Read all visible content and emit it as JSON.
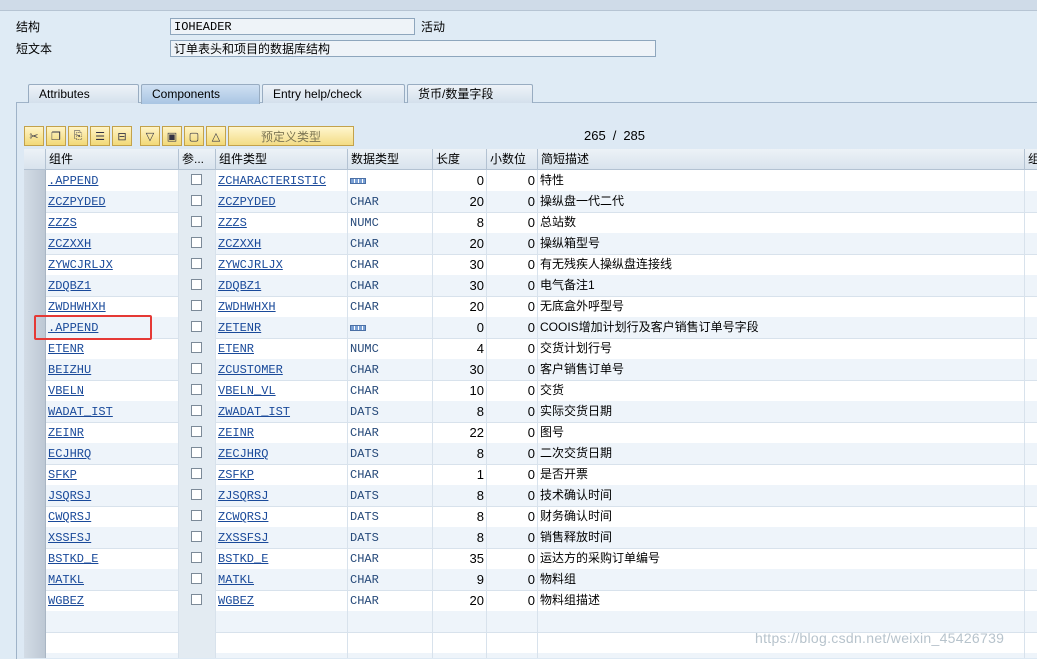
{
  "header": {
    "structure_label": "结构",
    "structure_value": "IOHEADER",
    "status": "活动",
    "shorttext_label": "短文本",
    "shorttext_value": "订单表头和项目的数据库结构"
  },
  "tabs": [
    {
      "label": "Attributes",
      "active": false
    },
    {
      "label": "Components",
      "active": true
    },
    {
      "label": "Entry help/check",
      "active": false
    },
    {
      "label": "货币/数量字段",
      "active": false
    }
  ],
  "toolbar": {
    "icons": [
      "cut-icon",
      "copy-icon",
      "paste-icon",
      "insert-row-icon",
      "delete-row-icon",
      "sort-icon",
      "select-all-icon",
      "deselect-icon",
      "scroll-up-icon"
    ],
    "predefined_type_label": "预定义类型"
  },
  "counter": {
    "current": "265",
    "separator": "/",
    "total": "285"
  },
  "columns": [
    "组件",
    "参...",
    "组件类型",
    "数据类型",
    "长度",
    "小数位",
    "简短描述",
    "组"
  ],
  "rows": [
    {
      "component": ".APPEND",
      "type": "ZCHARACTERISTIC",
      "dtype": "",
      "len": "0",
      "dec": "0",
      "desc": "特性",
      "struct": true
    },
    {
      "component": "ZCZPYDED",
      "type": "ZCZPYDED",
      "dtype": "CHAR",
      "len": "20",
      "dec": "0",
      "desc": "操纵盘一代二代",
      "struct": false
    },
    {
      "component": "ZZZS",
      "type": "ZZZS",
      "dtype": "NUMC",
      "len": "8",
      "dec": "0",
      "desc": "总站数",
      "struct": false
    },
    {
      "component": "ZCZXXH",
      "type": "ZCZXXH",
      "dtype": "CHAR",
      "len": "20",
      "dec": "0",
      "desc": "操纵箱型号",
      "struct": false
    },
    {
      "component": "ZYWCJRLJX",
      "type": "ZYWCJRLJX",
      "dtype": "CHAR",
      "len": "30",
      "dec": "0",
      "desc": "有无残疾人操纵盘连接线",
      "struct": false
    },
    {
      "component": "ZDQBZ1",
      "type": "ZDQBZ1",
      "dtype": "CHAR",
      "len": "30",
      "dec": "0",
      "desc": "电气备注1",
      "struct": false
    },
    {
      "component": "ZWDHWHXH",
      "type": "ZWDHWHXH",
      "dtype": "CHAR",
      "len": "20",
      "dec": "0",
      "desc": "无底盒外呼型号",
      "struct": false
    },
    {
      "component": ".APPEND",
      "type": "ZETENR",
      "dtype": "",
      "len": "0",
      "dec": "0",
      "desc": "COOIS增加计划行及客户销售订单号字段",
      "struct": true
    },
    {
      "component": "ETENR",
      "type": "ETENR",
      "dtype": "NUMC",
      "len": "4",
      "dec": "0",
      "desc": "交货计划行号",
      "struct": false
    },
    {
      "component": "BEIZHU",
      "type": "ZCUSTOMER",
      "dtype": "CHAR",
      "len": "30",
      "dec": "0",
      "desc": "客户销售订单号",
      "struct": false
    },
    {
      "component": "VBELN",
      "type": "VBELN_VL",
      "dtype": "CHAR",
      "len": "10",
      "dec": "0",
      "desc": "交货",
      "struct": false
    },
    {
      "component": "WADAT_IST",
      "type": "ZWADAT_IST",
      "dtype": "DATS",
      "len": "8",
      "dec": "0",
      "desc": "实际交货日期",
      "struct": false
    },
    {
      "component": "ZEINR",
      "type": "ZEINR",
      "dtype": "CHAR",
      "len": "22",
      "dec": "0",
      "desc": "图号",
      "struct": false
    },
    {
      "component": "ECJHRQ",
      "type": "ZECJHRQ",
      "dtype": "DATS",
      "len": "8",
      "dec": "0",
      "desc": "二次交货日期",
      "struct": false
    },
    {
      "component": "SFKP",
      "type": "ZSFKP",
      "dtype": "CHAR",
      "len": "1",
      "dec": "0",
      "desc": "是否开票",
      "struct": false
    },
    {
      "component": "JSQRSJ",
      "type": "ZJSQRSJ",
      "dtype": "DATS",
      "len": "8",
      "dec": "0",
      "desc": "技术确认时间",
      "struct": false
    },
    {
      "component": "CWQRSJ",
      "type": "ZCWQRSJ",
      "dtype": "DATS",
      "len": "8",
      "dec": "0",
      "desc": "财务确认时间",
      "struct": false
    },
    {
      "component": "XSSFSJ",
      "type": "ZXSSFSJ",
      "dtype": "DATS",
      "len": "8",
      "dec": "0",
      "desc": "销售释放时间",
      "struct": false
    },
    {
      "component": "BSTKD_E",
      "type": "BSTKD_E",
      "dtype": "CHAR",
      "len": "35",
      "dec": "0",
      "desc": "运达方的采购订单编号",
      "struct": false
    },
    {
      "component": "MATKL",
      "type": "MATKL",
      "dtype": "CHAR",
      "len": "9",
      "dec": "0",
      "desc": "物料组",
      "struct": false
    },
    {
      "component": "WGBEZ",
      "type": "WGBEZ",
      "dtype": "CHAR",
      "len": "20",
      "dec": "0",
      "desc": "物料组描述",
      "struct": false
    }
  ],
  "watermark": "https://blog.csdn.net/weixin_45426739",
  "colors": {
    "highlight": "#e53935",
    "link": "#1a4a9a",
    "toolbar_button": "#f2d978"
  }
}
